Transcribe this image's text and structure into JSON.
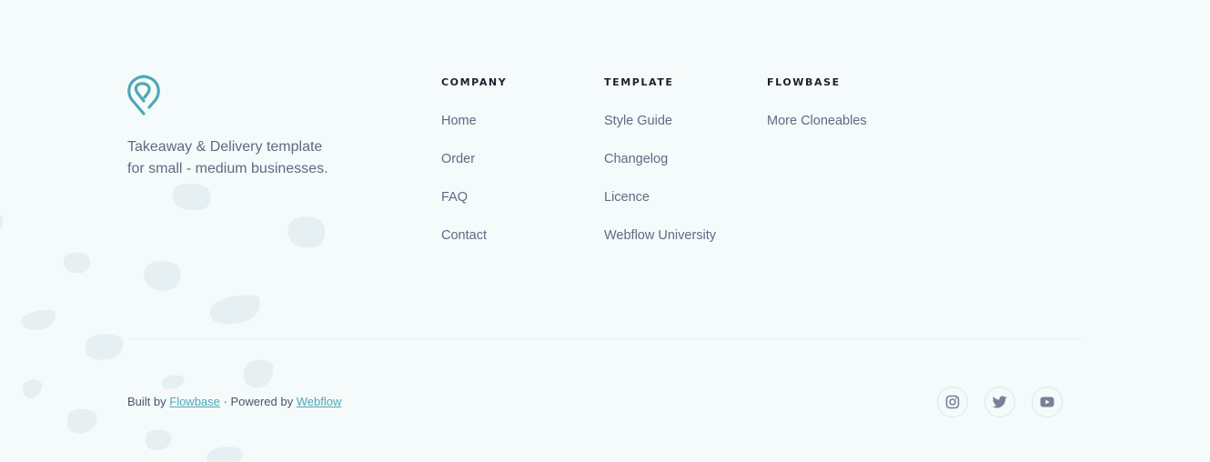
{
  "brand": {
    "logo_icon": "location-pin-icon",
    "tagline_line1": "Takeaway & Delivery template",
    "tagline_line2": "for small - medium businesses."
  },
  "columns": [
    {
      "title": "COMPANY",
      "links": [
        "Home",
        "Order",
        "FAQ",
        "Contact"
      ]
    },
    {
      "title": "TEMPLATE",
      "links": [
        "Style Guide",
        "Changelog",
        "Licence",
        "Webflow University"
      ]
    },
    {
      "title": "FLOWBASE",
      "links": [
        "More Cloneables"
      ]
    }
  ],
  "credits": {
    "built_by_prefix": "Built by ",
    "built_by_link": "Flowbase",
    "powered_prefix": " · Powered by ",
    "powered_link": "Webflow"
  },
  "socials": [
    {
      "icon": "instagram-icon"
    },
    {
      "icon": "twitter-icon"
    },
    {
      "icon": "youtube-icon"
    }
  ],
  "colors": {
    "background": "#f5fbfb",
    "accent": "#4fa8b4",
    "text_muted": "#5f6a80",
    "heading": "#1d1f2a"
  }
}
